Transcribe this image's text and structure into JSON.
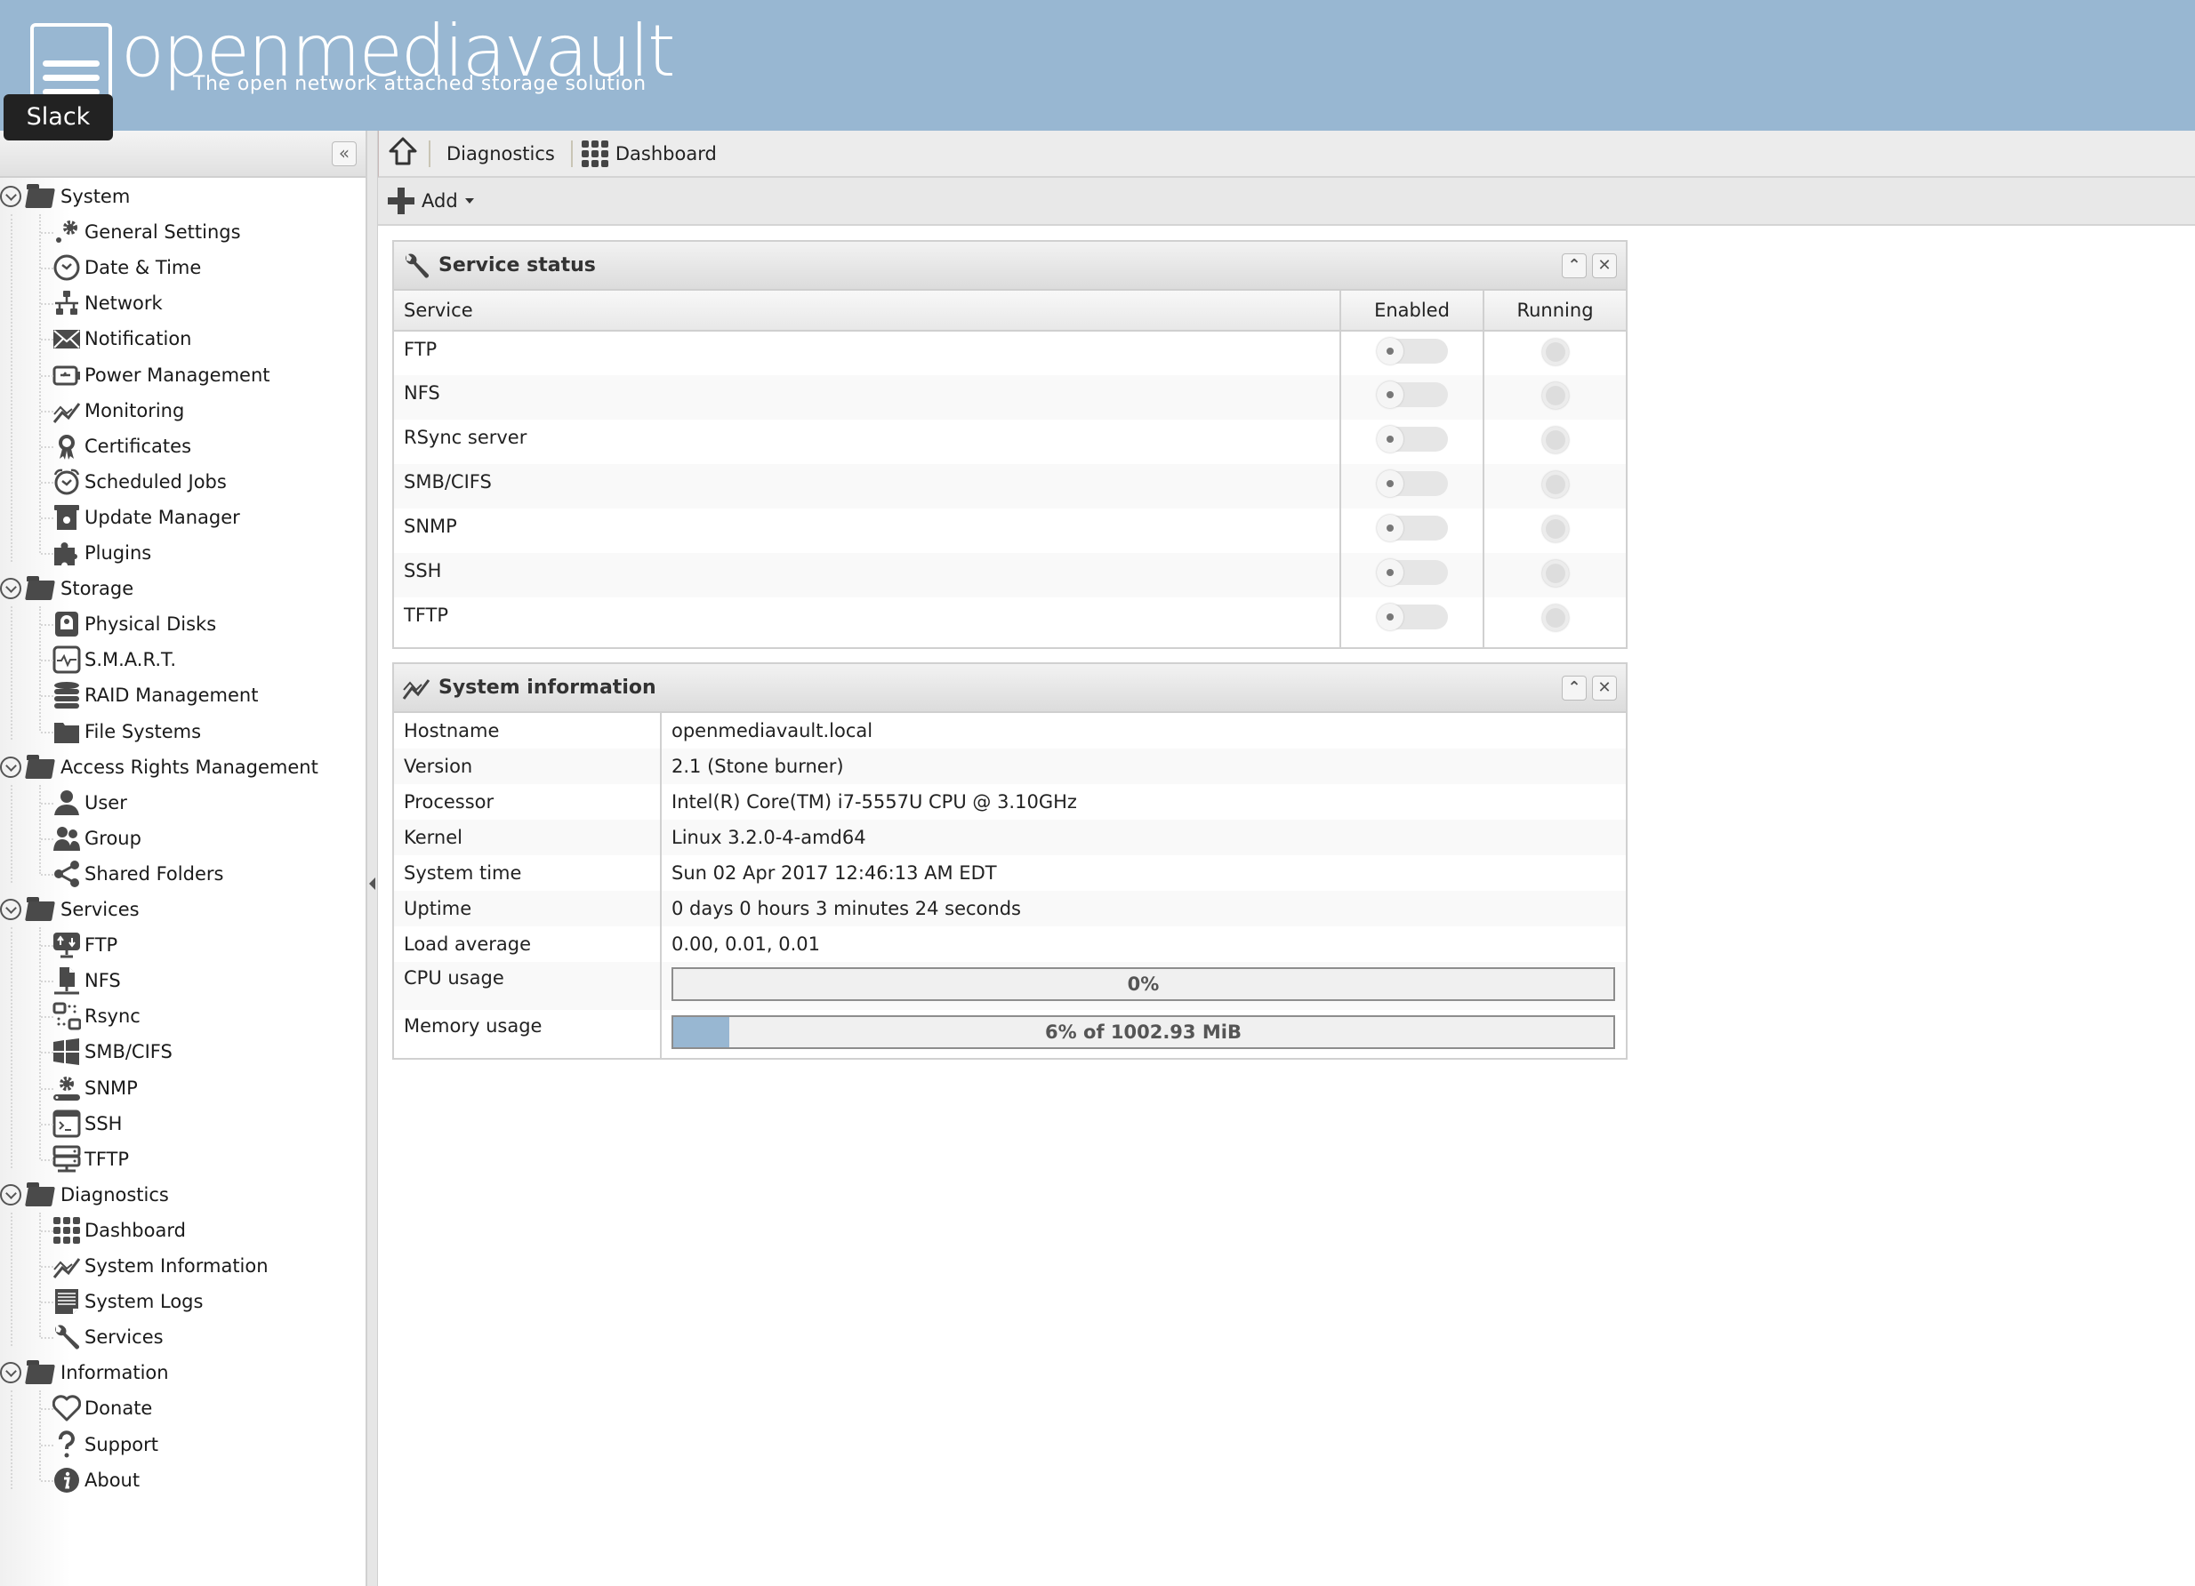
{
  "header": {
    "logo_text": "openmediavault",
    "tagline": "The open network attached storage solution",
    "tooltip": "Slack"
  },
  "sidebar": {
    "collapse_label": "«",
    "groups": [
      {
        "label": "System",
        "items": [
          {
            "label": "General Settings",
            "icon": "gears-icon"
          },
          {
            "label": "Date & Time",
            "icon": "clock-icon"
          },
          {
            "label": "Network",
            "icon": "network-icon"
          },
          {
            "label": "Notification",
            "icon": "envelope-icon"
          },
          {
            "label": "Power Management",
            "icon": "battery-icon"
          },
          {
            "label": "Monitoring",
            "icon": "line-chart-icon"
          },
          {
            "label": "Certificates",
            "icon": "certificate-icon"
          },
          {
            "label": "Scheduled Jobs",
            "icon": "alarm-clock-icon"
          },
          {
            "label": "Update Manager",
            "icon": "package-icon"
          },
          {
            "label": "Plugins",
            "icon": "puzzle-icon"
          }
        ]
      },
      {
        "label": "Storage",
        "items": [
          {
            "label": "Physical Disks",
            "icon": "disk-icon"
          },
          {
            "label": "S.M.A.R.T.",
            "icon": "heartbeat-icon"
          },
          {
            "label": "RAID Management",
            "icon": "database-icon"
          },
          {
            "label": "File Systems",
            "icon": "folder-icon"
          }
        ]
      },
      {
        "label": "Access Rights Management",
        "items": [
          {
            "label": "User",
            "icon": "user-icon"
          },
          {
            "label": "Group",
            "icon": "users-icon"
          },
          {
            "label": "Shared Folders",
            "icon": "share-icon"
          }
        ]
      },
      {
        "label": "Services",
        "items": [
          {
            "label": "FTP",
            "icon": "ftp-icon"
          },
          {
            "label": "NFS",
            "icon": "nfs-icon"
          },
          {
            "label": "Rsync",
            "icon": "rsync-icon"
          },
          {
            "label": "SMB/CIFS",
            "icon": "windows-icon"
          },
          {
            "label": "SNMP",
            "icon": "snmp-icon"
          },
          {
            "label": "SSH",
            "icon": "terminal-icon"
          },
          {
            "label": "TFTP",
            "icon": "server-icon"
          }
        ]
      },
      {
        "label": "Diagnostics",
        "items": [
          {
            "label": "Dashboard",
            "icon": "dashboard-grid-icon"
          },
          {
            "label": "System Information",
            "icon": "line-chart-icon"
          },
          {
            "label": "System Logs",
            "icon": "log-icon"
          },
          {
            "label": "Services",
            "icon": "wrench-icon"
          }
        ]
      },
      {
        "label": "Information",
        "items": [
          {
            "label": "Donate",
            "icon": "heart-icon"
          },
          {
            "label": "Support",
            "icon": "question-icon"
          },
          {
            "label": "About",
            "icon": "info-icon"
          }
        ]
      }
    ]
  },
  "breadcrumb": {
    "items": [
      "Diagnostics",
      "Dashboard"
    ]
  },
  "toolbar": {
    "add_label": "Add"
  },
  "service_status": {
    "title": "Service status",
    "columns": [
      "Service",
      "Enabled",
      "Running"
    ],
    "rows": [
      {
        "service": "FTP",
        "enabled": false,
        "running": false
      },
      {
        "service": "NFS",
        "enabled": false,
        "running": false
      },
      {
        "service": "RSync server",
        "enabled": false,
        "running": false
      },
      {
        "service": "SMB/CIFS",
        "enabled": false,
        "running": false
      },
      {
        "service": "SNMP",
        "enabled": false,
        "running": false
      },
      {
        "service": "SSH",
        "enabled": false,
        "running": false
      },
      {
        "service": "TFTP",
        "enabled": false,
        "running": false
      }
    ]
  },
  "system_information": {
    "title": "System information",
    "rows": [
      {
        "key": "Hostname",
        "value": "openmediavault.local"
      },
      {
        "key": "Version",
        "value": "2.1 (Stone burner)"
      },
      {
        "key": "Processor",
        "value": "Intel(R) Core(TM) i7-5557U CPU @ 3.10GHz"
      },
      {
        "key": "Kernel",
        "value": "Linux 3.2.0-4-amd64"
      },
      {
        "key": "System time",
        "value": "Sun 02 Apr 2017 12:46:13 AM EDT"
      },
      {
        "key": "Uptime",
        "value": "0 days 0 hours 3 minutes 24 seconds"
      },
      {
        "key": "Load average",
        "value": "0.00, 0.01, 0.01"
      }
    ],
    "cpu_usage": {
      "label": "CPU usage",
      "percent": 0,
      "text": "0%"
    },
    "memory_usage": {
      "label": "Memory usage",
      "percent": 6,
      "text": "6% of 1002.93 MiB"
    }
  },
  "colors": {
    "header_bg": "#98b7d2",
    "progress_fill": "#98b7d2"
  }
}
